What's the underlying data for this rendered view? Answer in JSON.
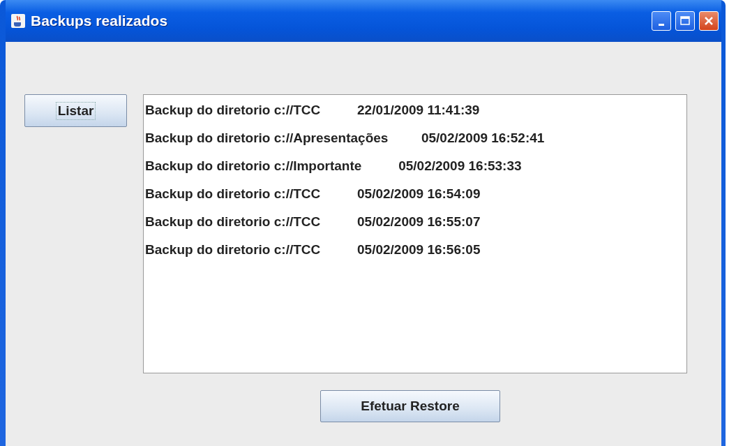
{
  "window": {
    "title": "Backups realizados"
  },
  "list_button": {
    "label": "Listar",
    "focused": true
  },
  "backups": [
    "Backup do diretorio c://TCC          22/01/2009 11:41:39",
    "Backup do diretorio c://Apresentações         05/02/2009 16:52:41",
    "Backup do diretorio c://Importante          05/02/2009 16:53:33",
    "Backup do diretorio c://TCC          05/02/2009 16:54:09",
    "Backup do diretorio c://TCC          05/02/2009 16:55:07",
    "Backup do diretorio c://TCC          05/02/2009 16:56:05"
  ],
  "restore_button": {
    "label": "Efetuar Restore",
    "focused": false
  }
}
